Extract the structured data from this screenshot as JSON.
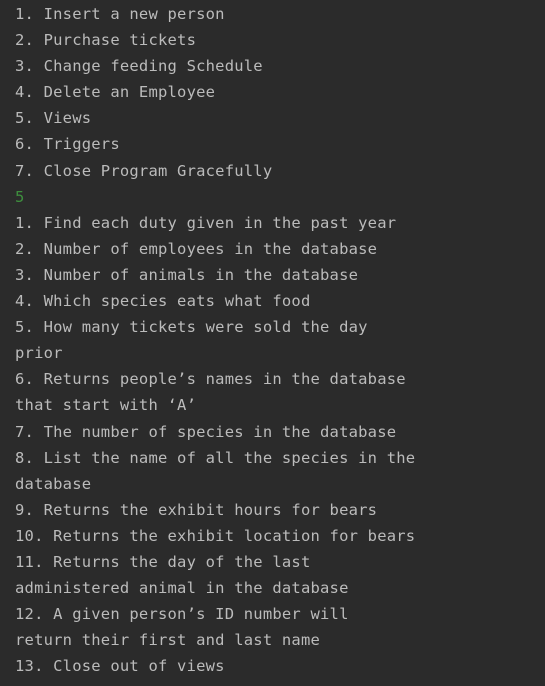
{
  "colors": {
    "background": "#2b2b2b",
    "text": "#bbbbbb",
    "input_echo": "#3e8f3e"
  },
  "main_menu": [
    "1. Insert a new person",
    "2. Purchase tickets",
    "3. Change feeding Schedule",
    "4. Delete an Employee",
    "5. Views",
    "6. Triggers",
    "7. Close Program Gracefully"
  ],
  "user_input": "5",
  "views_menu": [
    "1. Find each duty given in the past year",
    "2. Number of employees in the database",
    "3. Number of animals in the database",
    "4. Which species eats what food",
    "5. How many tickets were sold the day",
    "prior",
    "6. Returns people’s names in the database",
    "that start with ‘A’",
    "7. The number of species in the database",
    "8. List the name of all the species in the",
    "database",
    "9. Returns the exhibit hours for bears",
    "10. Returns the exhibit location for bears",
    "11. Returns the day of the last",
    "administered animal in the database",
    "12. A given person’s ID number will",
    "return their first and last name",
    "13. Close out of views"
  ]
}
